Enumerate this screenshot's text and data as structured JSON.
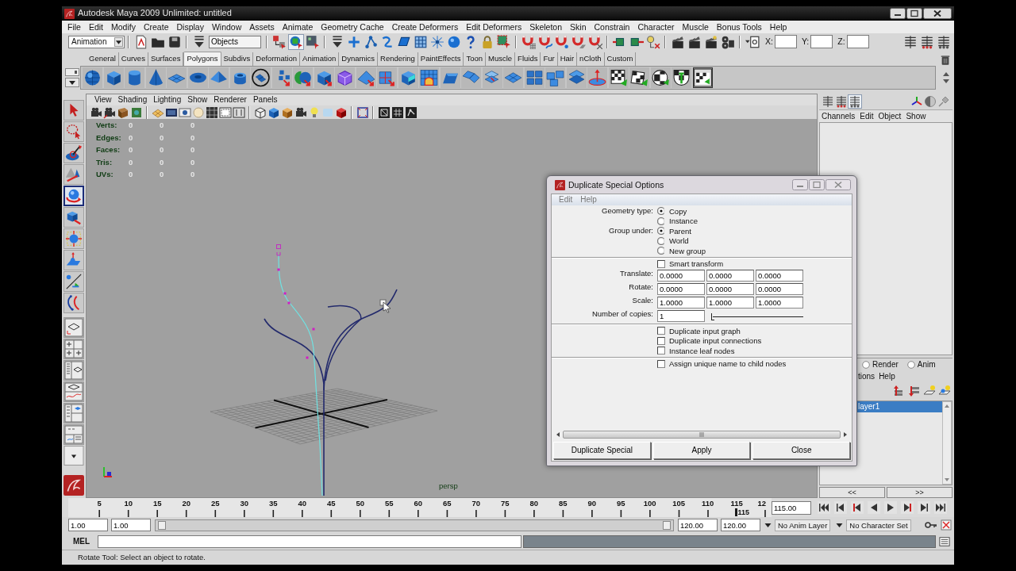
{
  "window": {
    "title": "Autodesk Maya 2009 Unlimited: untitled"
  },
  "menu_bar": [
    "File",
    "Edit",
    "Modify",
    "Create",
    "Display",
    "Window",
    "Assets",
    "Animate",
    "Geometry Cache",
    "Create Deformers",
    "Edit Deformers",
    "Skeleton",
    "Skin",
    "Constrain",
    "Character",
    "Muscle",
    "Bonus Tools",
    "Help"
  ],
  "status_line": {
    "menu_set": "Animation",
    "selection_field": "Objects",
    "selection_modes": [
      {
        "selected": false
      },
      {
        "selected": true
      },
      {
        "selected": false
      }
    ],
    "coordinates": [
      {
        "label": "X:"
      },
      {
        "label": "Y:"
      },
      {
        "label": "Z:"
      }
    ]
  },
  "shelf": {
    "tabs": [
      {
        "label": "General",
        "selected": false
      },
      {
        "label": "Curves",
        "selected": false
      },
      {
        "label": "Surfaces",
        "selected": false
      },
      {
        "label": "Polygons",
        "selected": true
      },
      {
        "label": "Subdivs",
        "selected": false
      },
      {
        "label": "Deformation",
        "selected": false
      },
      {
        "label": "Animation",
        "selected": false
      },
      {
        "label": "Dynamics",
        "selected": false
      },
      {
        "label": "Rendering",
        "selected": false
      },
      {
        "label": "PaintEffects",
        "selected": false
      },
      {
        "label": "Toon",
        "selected": false
      },
      {
        "label": "Muscle",
        "selected": false
      },
      {
        "label": "Fluids",
        "selected": false
      },
      {
        "label": "Fur",
        "selected": false
      },
      {
        "label": "Hair",
        "selected": false
      },
      {
        "label": "nCloth",
        "selected": false
      },
      {
        "label": "Custom",
        "selected": false
      }
    ]
  },
  "toolbox": {
    "tools": [
      {
        "selected": false
      },
      {
        "selected": false
      },
      {
        "selected": false
      },
      {
        "selected": false
      },
      {
        "selected": true
      },
      {
        "selected": false
      },
      {
        "selected": false
      },
      {
        "selected": false
      },
      {
        "selected": false
      },
      {
        "selected": false
      }
    ]
  },
  "viewport": {
    "menu": [
      "View",
      "Shading",
      "Lighting",
      "Show",
      "Renderer",
      "Panels"
    ],
    "hud": [
      {
        "label": "Verts:",
        "values": [
          "0",
          "0",
          "0"
        ]
      },
      {
        "label": "Edges:",
        "values": [
          "0",
          "0",
          "0"
        ]
      },
      {
        "label": "Faces:",
        "values": [
          "0",
          "0",
          "0"
        ]
      },
      {
        "label": "Tris:",
        "values": [
          "0",
          "0",
          "0"
        ]
      },
      {
        "label": "UVs:",
        "values": [
          "0",
          "0",
          "0"
        ]
      }
    ],
    "camera": "persp"
  },
  "channel_box": {
    "toggles": [
      {
        "selected": false
      },
      {
        "selected": false
      },
      {
        "selected": true
      }
    ],
    "menu": [
      "Channels",
      "Edit",
      "Object",
      "Show"
    ]
  },
  "layer_editor": {
    "modes": [
      {
        "label": "Render",
        "selected": false
      },
      {
        "label": "Anim",
        "selected": false
      }
    ],
    "menu": [
      "tions",
      "Help"
    ],
    "layers": [
      {
        "name": "layer1",
        "selected": true
      }
    ],
    "page_buttons": [
      "<<",
      ">>"
    ]
  },
  "dialog": {
    "title": "Duplicate Special Options",
    "menu": [
      "Edit",
      "Help"
    ],
    "radio_groups": [
      {
        "label": "Geometry type:",
        "options": [
          {
            "label": "Copy",
            "selected": true
          },
          {
            "label": "Instance",
            "selected": false
          }
        ]
      },
      {
        "label": "Group under:",
        "options": [
          {
            "label": "Parent",
            "selected": true
          },
          {
            "label": "World",
            "selected": false
          },
          {
            "label": "New group",
            "selected": false
          }
        ]
      }
    ],
    "smart_transform": {
      "label": "Smart transform",
      "checked": false
    },
    "vectors": [
      {
        "label": "Translate:",
        "values": [
          "0.0000",
          "0.0000",
          "0.0000"
        ]
      },
      {
        "label": "Rotate:",
        "values": [
          "0.0000",
          "0.0000",
          "0.0000"
        ]
      },
      {
        "label": "Scale:",
        "values": [
          "1.0000",
          "1.0000",
          "1.0000"
        ]
      }
    ],
    "copies": {
      "label": "Number of copies:",
      "value": "1",
      "level": 0
    },
    "input_options": [
      {
        "label": "Duplicate input graph",
        "checked": false
      },
      {
        "label": "Duplicate input connections",
        "checked": false
      },
      {
        "label": "Instance leaf nodes",
        "checked": false
      }
    ],
    "naming_options": [
      {
        "label": "Assign unique name to child nodes",
        "checked": false
      }
    ],
    "buttons": [
      "Duplicate Special",
      "Apply",
      "Close"
    ]
  },
  "time_slider": {
    "ticks": [
      "5",
      "10",
      "15",
      "20",
      "25",
      "30",
      "35",
      "40",
      "45",
      "50",
      "55",
      "60",
      "65",
      "70",
      "75",
      "80",
      "85",
      "90",
      "95",
      "100",
      "105",
      "110",
      "115",
      "12"
    ],
    "current": {
      "label": "115",
      "level": 0.958
    },
    "current_time": "115.00"
  },
  "range_slider": {
    "start_time": "1.00",
    "playback_start": "1.00",
    "handles": [
      {
        "level": 0
      },
      {
        "level": 1
      }
    ],
    "playback_end": "120.00",
    "end_time": "120.00",
    "anim_layer": "No Anim Layer",
    "character_set": "No Character Set"
  },
  "command_line": {
    "label": "MEL"
  },
  "help_line": "Rotate Tool: Select an object to rotate."
}
